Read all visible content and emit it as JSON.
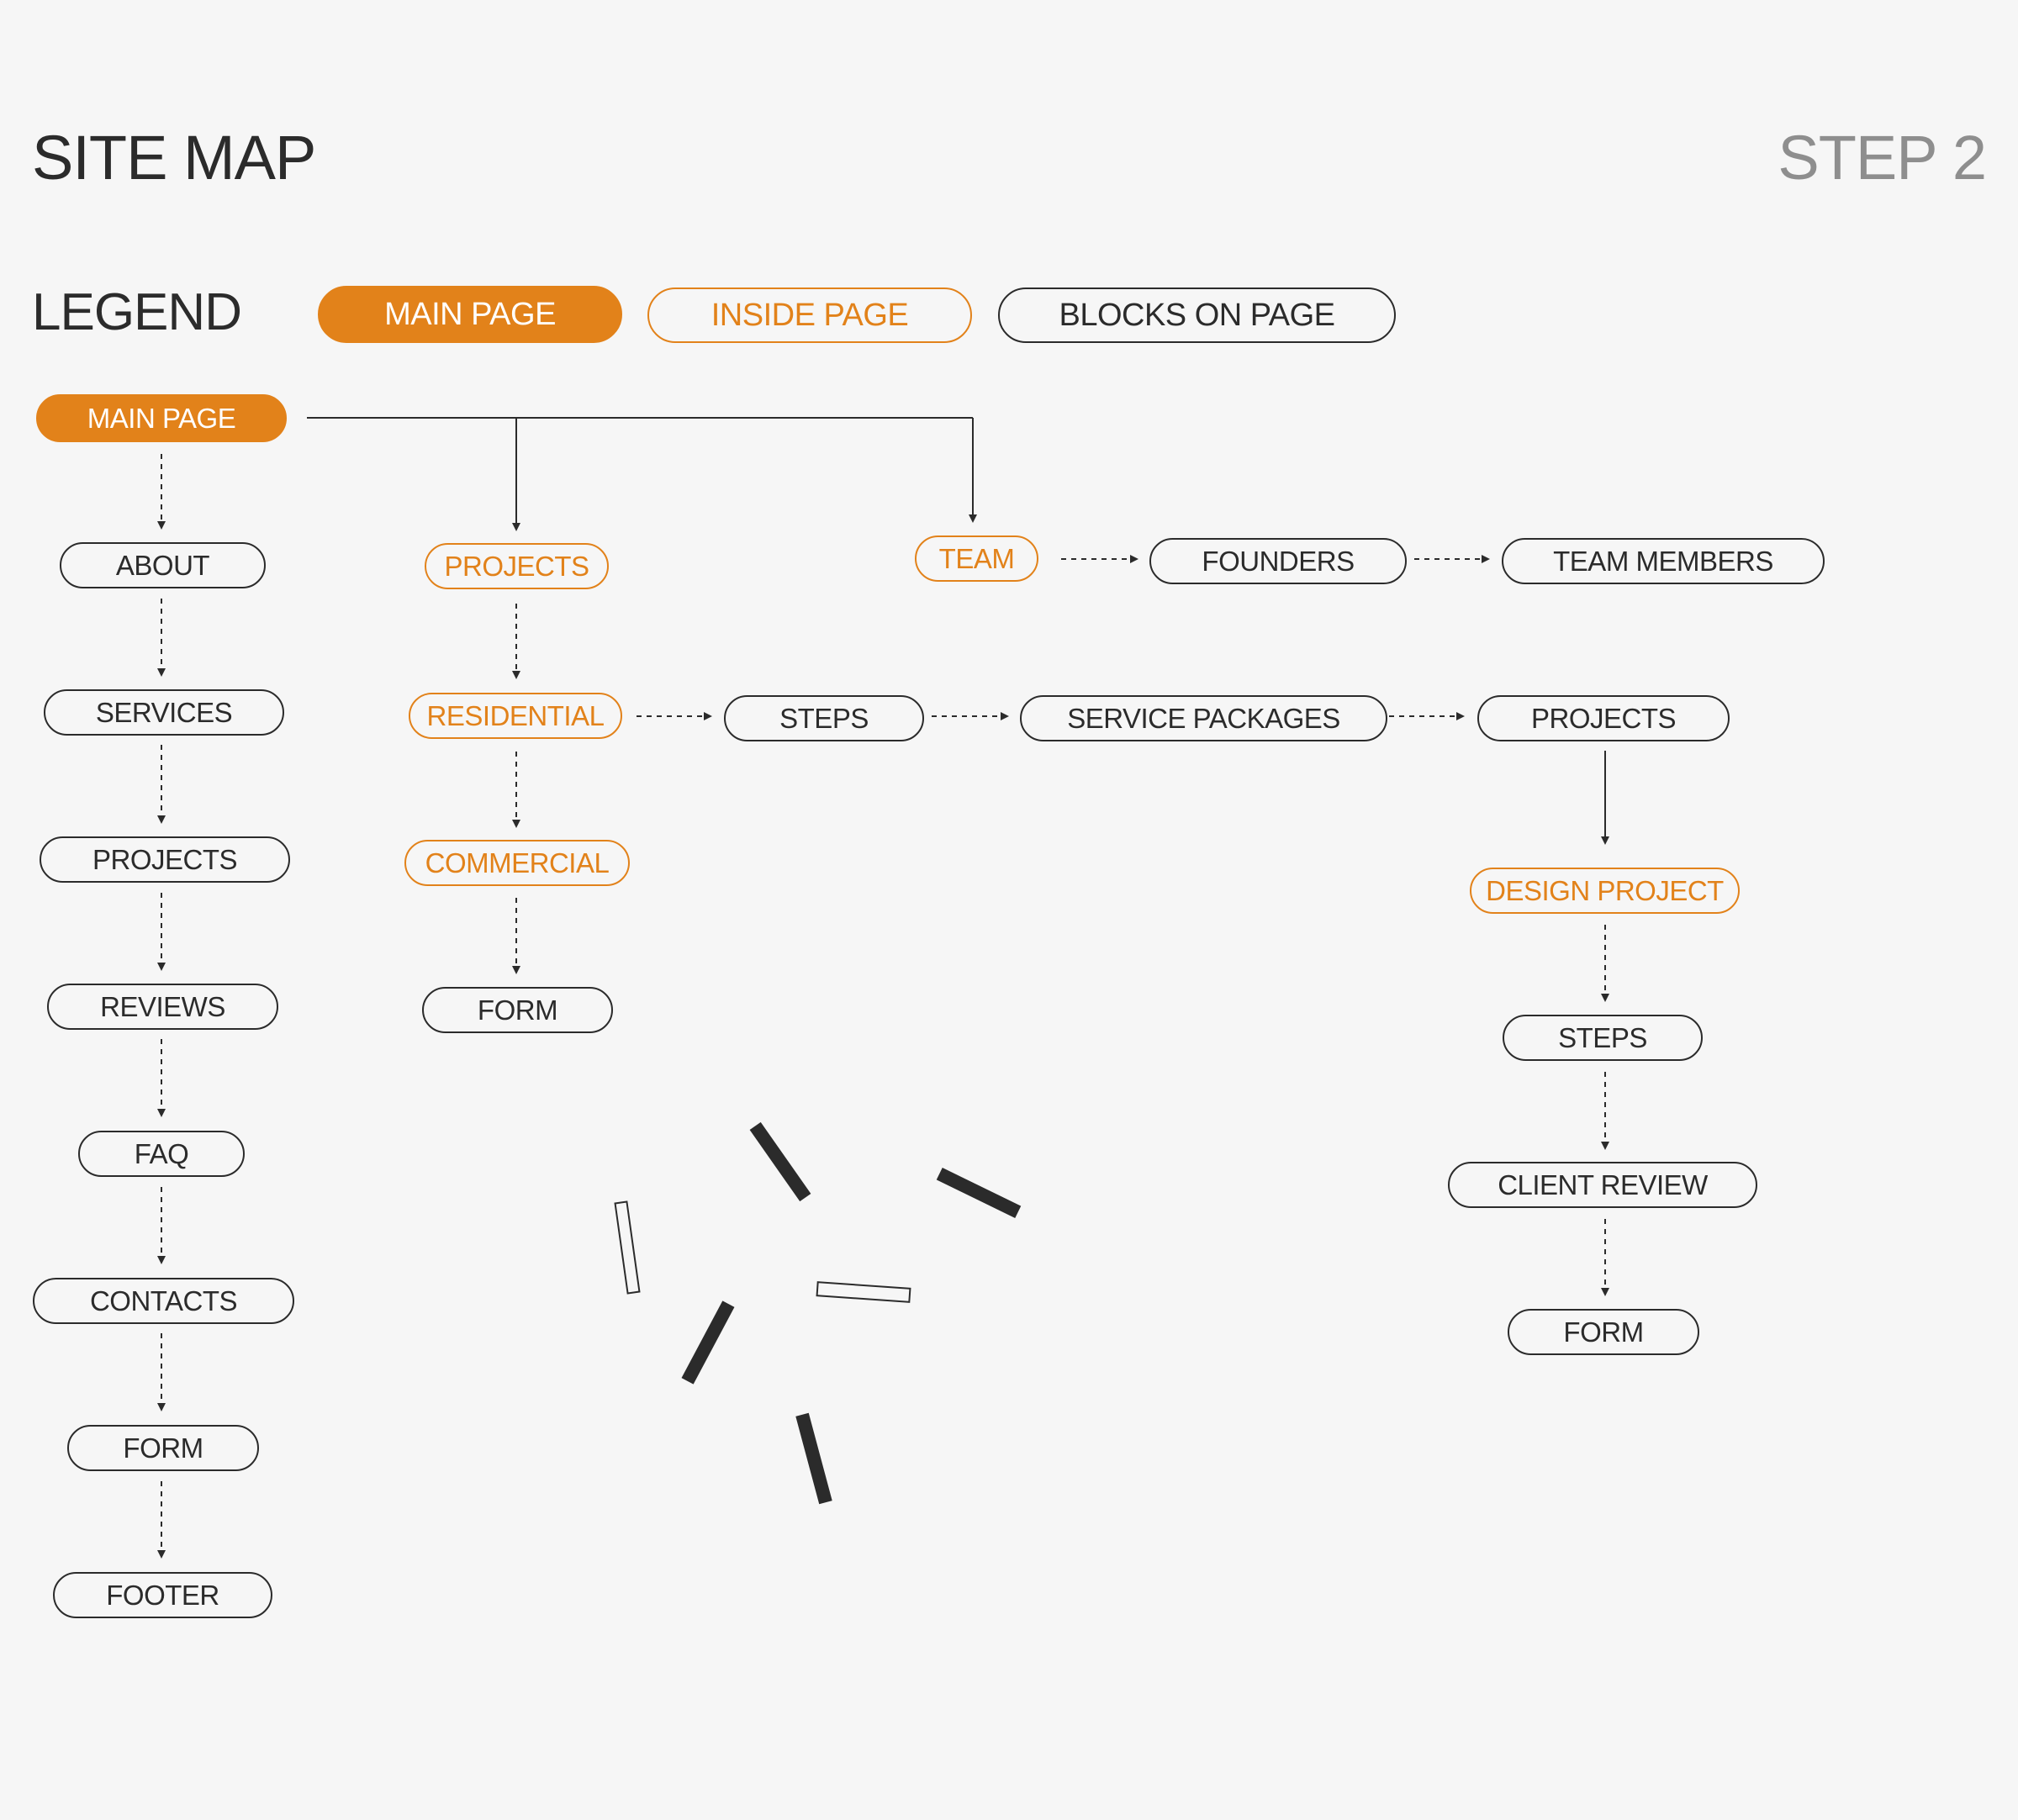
{
  "header": {
    "title": "SITE MAP",
    "step": "STEP 2"
  },
  "legend": {
    "label": "LEGEND",
    "main_page": "MAIN PAGE",
    "inside_page": "INSIDE PAGE",
    "blocks_on_page": "BLOCKS ON PAGE"
  },
  "colors": {
    "accent": "#e2821a",
    "ink": "#2b2b2b",
    "muted": "#8e8e8e",
    "background": "#f6f6f6"
  },
  "sitemap": {
    "main_page": "MAIN PAGE",
    "main_blocks": [
      "ABOUT",
      "SERVICES",
      "PROJECTS",
      "REVIEWS",
      "FAQ",
      "CONTACTS",
      "FORM",
      "FOOTER"
    ],
    "projects": {
      "page": "PROJECTS",
      "residential": "RESIDENTIAL",
      "commercial": "COMMERCIAL",
      "form": "FORM",
      "residential_blocks": [
        "STEPS",
        "SERVICE PACKAGES",
        "PROJECTS"
      ],
      "design_project": {
        "page": "DESIGN PROJECT",
        "blocks": [
          "STEPS",
          "CLIENT REVIEW",
          "FORM"
        ]
      }
    },
    "team": {
      "page": "TEAM",
      "blocks": [
        "FOUNDERS",
        "TEAM MEMBERS"
      ]
    }
  }
}
